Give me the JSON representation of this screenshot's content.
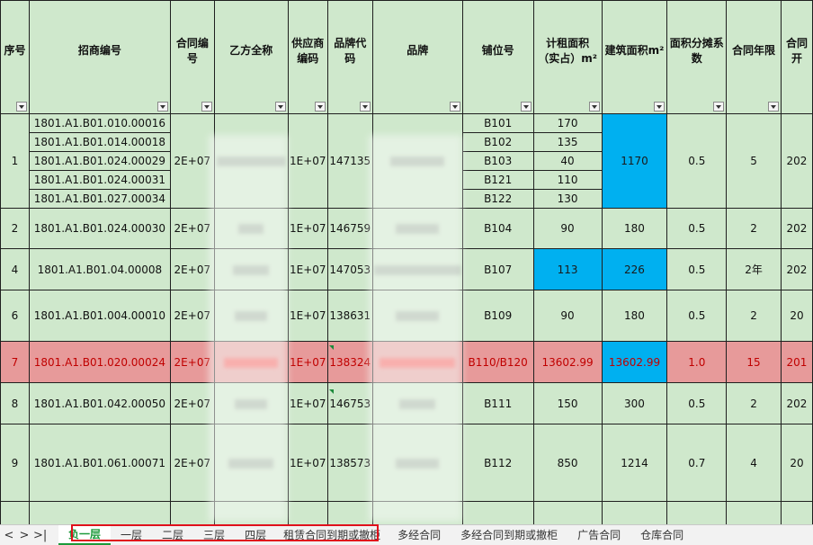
{
  "sheet": {
    "headers": [
      "序号",
      "招商编号",
      "合同编号",
      "乙方全称",
      "供应商编码",
      "品牌代码",
      "品牌",
      "铺位号",
      "计租面积（实占）m²",
      "建筑面积m²",
      "面积分摊系数",
      "合同年限",
      "合同开"
    ],
    "rows": [
      {
        "seq": "1",
        "codes": [
          "1801.A1.B01.010.00016",
          "1801.A1.B01.014.00018",
          "1801.A1.B01.024.00029",
          "1801.A1.B01.024.00031",
          "1801.A1.B01.027.00034"
        ],
        "contract": "2E+07",
        "supplier": "1E+07",
        "brand_code": "147135",
        "units": [
          "B101",
          "B102",
          "B103",
          "B121",
          "B122"
        ],
        "rent_areas": [
          "170",
          "135",
          "40",
          "110",
          "130"
        ],
        "build_area": "1170",
        "factor": "0.5",
        "years": "5",
        "start": "202"
      },
      {
        "seq": "2",
        "code": "1801.A1.B01.024.00030",
        "contract": "2E+07",
        "supplier": "1E+07",
        "brand_code": "146759",
        "unit": "B104",
        "rent_area": "90",
        "build_area": "180",
        "factor": "0.5",
        "years": "2",
        "start": "202"
      },
      {
        "seq": "4",
        "code": "1801.A1.B01.04.00008",
        "contract": "2E+07",
        "supplier": "1E+07",
        "brand_code": "147053",
        "unit": "B107",
        "rent_area": "113",
        "build_area": "226",
        "factor": "0.5",
        "years": "2年",
        "start": "202"
      },
      {
        "seq": "6",
        "code": "1801.A1.B01.004.00010",
        "contract": "2E+07",
        "supplier": "1E+07",
        "brand_code": "138631",
        "unit": "B109",
        "rent_area": "90",
        "build_area": "180",
        "factor": "0.5",
        "years": "2",
        "start": "20"
      },
      {
        "seq": "7",
        "code": "1801.A1.B01.020.00024",
        "contract": "2E+07",
        "supplier": "1E+07",
        "brand_code": "138324",
        "unit": "B110/B120",
        "rent_area": "13602.99",
        "build_area": "13602.99",
        "factor": "1.0",
        "years": "15",
        "start": "201"
      },
      {
        "seq": "8",
        "code": "1801.A1.B01.042.00050",
        "contract": "2E+07",
        "supplier": "1E+07",
        "brand_code": "146753",
        "unit": "B111",
        "rent_area": "150",
        "build_area": "300",
        "factor": "0.5",
        "years": "2",
        "start": "202"
      },
      {
        "seq": "9",
        "code": "1801.A1.B01.061.00071",
        "contract": "2E+07",
        "supplier": "1E+07",
        "brand_code": "138573",
        "unit": "B112",
        "rent_area": "850",
        "build_area": "1214",
        "factor": "0.7",
        "years": "4",
        "start": "20"
      }
    ]
  },
  "tabs": [
    "负一层",
    "一层",
    "二层",
    "三层",
    "四层",
    "租赁合同到期或撤柜",
    "多经合同",
    "多经合同到期或撤柜",
    "广告合同",
    "仓库合同"
  ],
  "active_tab": "负一层",
  "nav_icons": [
    "prev-sheet-icon",
    "next-sheet-icon",
    "last-sheet-icon"
  ],
  "colors": {
    "cell_green": "#cfe8cc",
    "highlight_blue": "#00b0f0",
    "row_red": "#e79a9a",
    "red_text": "#c00000",
    "active_tab": "#1b9a3a",
    "outline_red": "#e0101b"
  }
}
